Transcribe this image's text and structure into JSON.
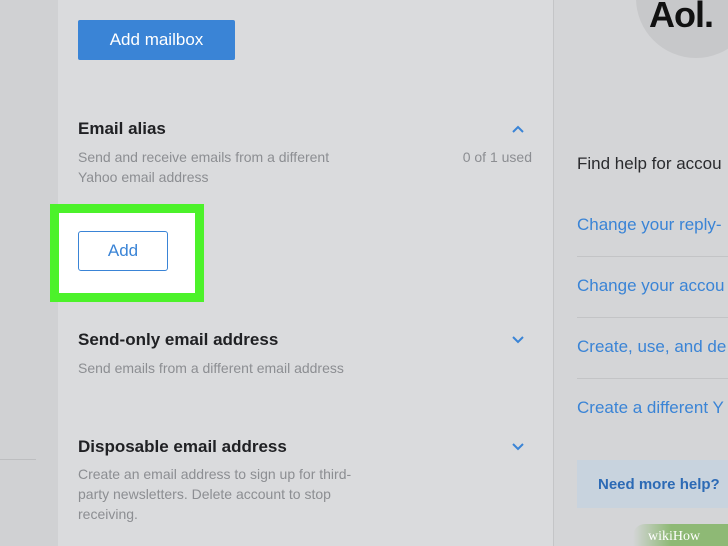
{
  "main": {
    "add_mailbox_label": "Add mailbox",
    "email_alias": {
      "title": "Email alias",
      "desc": "Send and receive emails from a different\nYahoo email address",
      "usage": "0 of 1 used",
      "add_label": "Add"
    },
    "send_only": {
      "title": "Send-only email address",
      "desc": "Send emails from a different email address"
    },
    "disposable": {
      "title": "Disposable email address",
      "desc": "Create an email address to sign up for third-\nparty newsletters. Delete account to stop\nreceiving."
    }
  },
  "right": {
    "logo_text": "Aol.",
    "help_heading": "Find help for accou",
    "links": [
      "Change your reply-",
      "Change your accou",
      "Create, use, and de",
      "Create a different Y"
    ],
    "more_help": "Need more help?"
  },
  "watermark": "wikiHow",
  "colors": {
    "accent": "#3a84d6",
    "highlight": "#4cf22a",
    "text_dark": "#202124",
    "text_muted": "#8c8e92"
  },
  "icons": {
    "email_alias_chevron": "chevron-up-icon",
    "send_only_chevron": "chevron-down-icon",
    "disposable_chevron": "chevron-down-icon"
  }
}
